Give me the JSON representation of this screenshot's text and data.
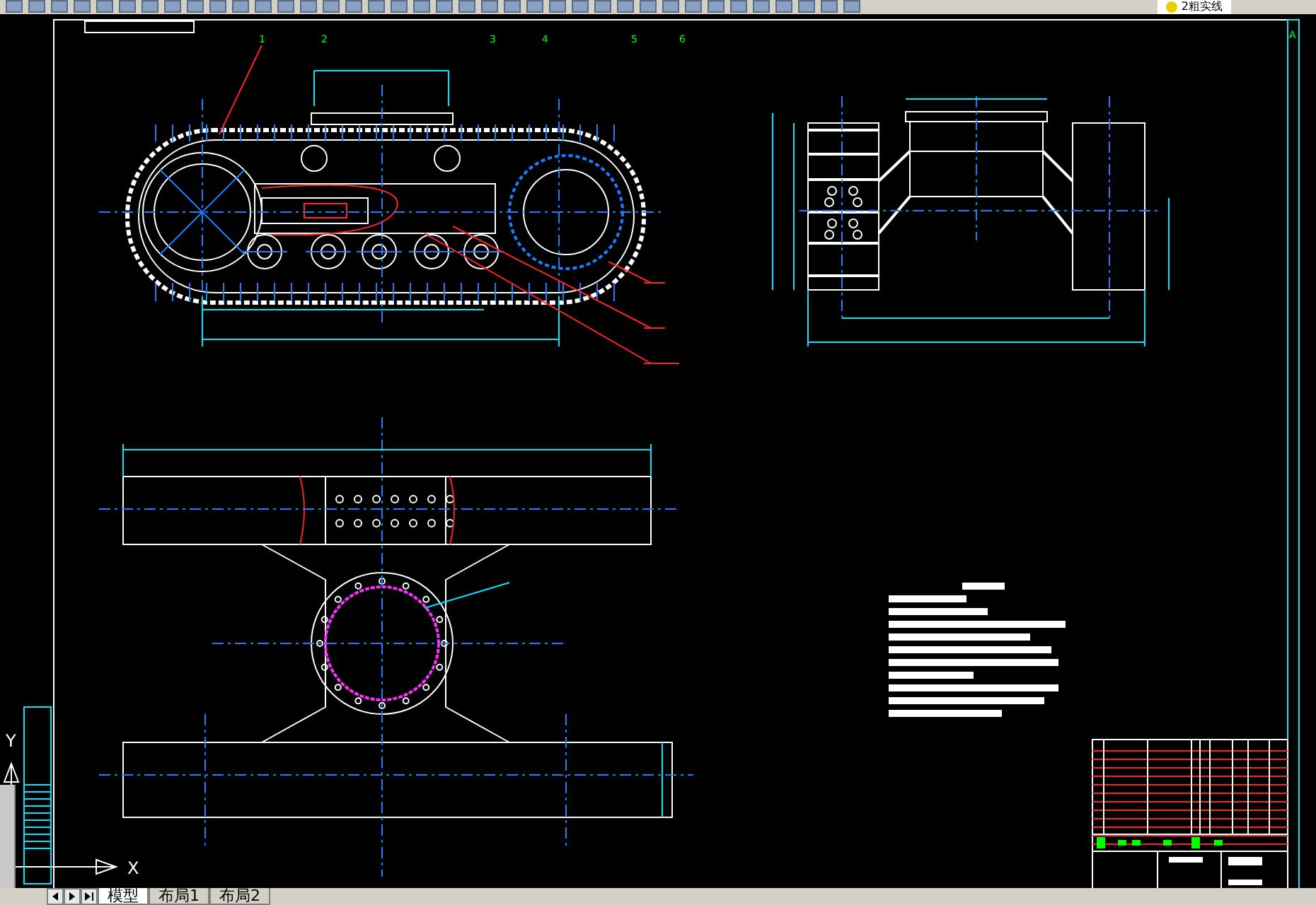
{
  "toolbar": {
    "layer": "2粗实线"
  },
  "drawing": {
    "zone_numbers": [
      "1",
      "2",
      "3",
      "4",
      "5",
      "6"
    ],
    "zone_letter": "A"
  },
  "ucs": {
    "y_label": "Y",
    "x_label": "X"
  },
  "layout_tabs": [
    {
      "label": "模型",
      "selected": true
    },
    {
      "label": "布局1",
      "selected": false
    },
    {
      "label": "布局2",
      "selected": false
    }
  ]
}
